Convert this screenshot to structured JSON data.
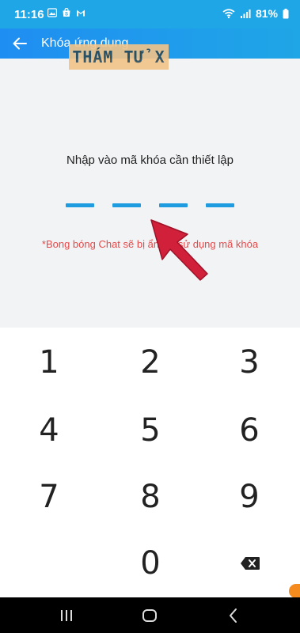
{
  "status_bar": {
    "time": "11:16",
    "battery": "81%",
    "notification_icons": [
      "image-icon",
      "shopee-icon",
      "gmail-icon"
    ]
  },
  "app_bar": {
    "title": "Khóa ứng dụng"
  },
  "watermark": {
    "text": "THÁM TỬ X"
  },
  "lock_setup": {
    "prompt": "Nhập vào mã khóa cần thiết lập",
    "pin_slots": 4,
    "notice": "*Bong bóng Chat sẽ bị ẩn khi sử dụng mã khóa"
  },
  "keypad": {
    "keys": [
      "1",
      "2",
      "3",
      "4",
      "5",
      "6",
      "7",
      "8",
      "9",
      "0"
    ]
  },
  "colors": {
    "accent": "#1fa6e6",
    "warning_text": "#e34b4b",
    "arrow": "#d1213a"
  }
}
